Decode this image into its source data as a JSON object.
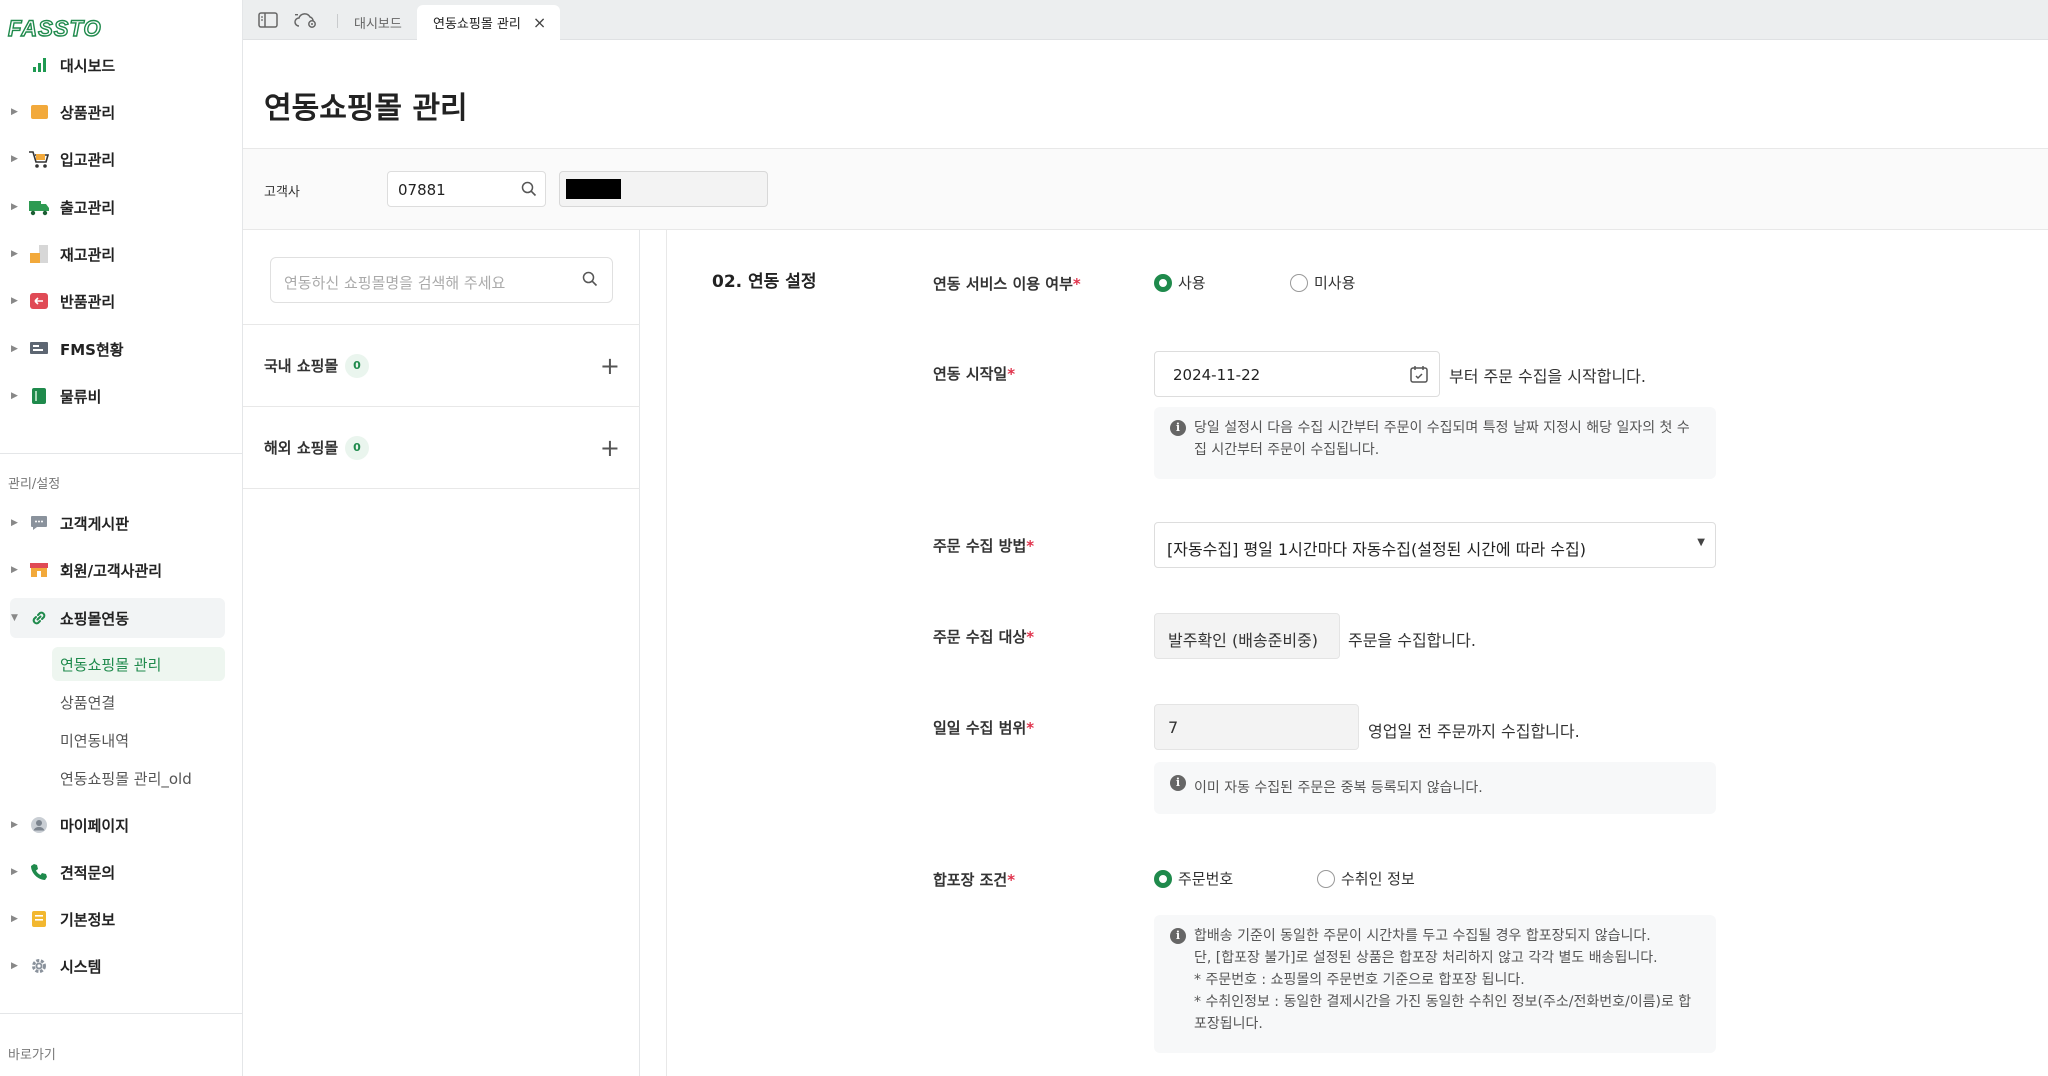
{
  "app": {
    "logo": "FASSTO"
  },
  "sidebar": {
    "menu": [
      {
        "label": "대시보드",
        "icon": "bar-chart-icon"
      },
      {
        "label": "상품관리",
        "icon": "box-icon"
      },
      {
        "label": "입고관리",
        "icon": "cart-icon"
      },
      {
        "label": "출고관리",
        "icon": "truck-icon"
      },
      {
        "label": "재고관리",
        "icon": "stock-icon"
      },
      {
        "label": "반품관리",
        "icon": "return-icon"
      },
      {
        "label": "FMS현황",
        "icon": "monitor-icon"
      },
      {
        "label": "물류비",
        "icon": "book-icon"
      }
    ],
    "admin_section_label": "관리/설정",
    "admin_menu": [
      {
        "label": "고객게시판",
        "icon": "chat-icon"
      },
      {
        "label": "회원/고객사관리",
        "icon": "store-icon"
      },
      {
        "label": "쇼핑몰연동",
        "icon": "link-icon"
      }
    ],
    "submenu": [
      "연동쇼핑몰 관리",
      "상품연결",
      "미연동내역",
      "연동쇼핑몰 관리_old"
    ],
    "bottom_menu": [
      {
        "label": "마이페이지",
        "icon": "user-icon"
      },
      {
        "label": "견적문의",
        "icon": "phone-icon"
      },
      {
        "label": "기본정보",
        "icon": "note-icon"
      },
      {
        "label": "시스템",
        "icon": "gear-icon"
      }
    ],
    "shortcut_label": "바로가기"
  },
  "tabs": {
    "items": [
      "대시보드",
      "연동쇼핑몰 관리"
    ],
    "close": "×"
  },
  "page": {
    "title": "연동쇼핑몰 관리"
  },
  "filter": {
    "label": "고객사",
    "customer_code": "07881"
  },
  "list": {
    "search_placeholder": "연동하신 쇼핑몰명을 검색해 주세요",
    "groups": [
      {
        "name": "국내 쇼핑몰",
        "count": "0"
      },
      {
        "name": "해외 쇼핑몰",
        "count": "0"
      }
    ],
    "plus": "+"
  },
  "settings": {
    "section_title": "02. 연동 설정",
    "service_use": {
      "label": "연동 서비스 이용 여부",
      "options": [
        "사용",
        "미사용"
      ],
      "selected": "사용"
    },
    "start_date": {
      "label": "연동 시작일",
      "value": "2024-11-22",
      "suffix": "부터 주문 수집을 시작합니다.",
      "info": [
        "당일 설정시 다음 수집 시간부터 주문이 수집되며 특정 날짜 지정시 해당 일자의 첫 수",
        "집 시간부터 주문이 수집됩니다."
      ]
    },
    "collect_method": {
      "label": "주문 수집 방법",
      "value": "[자동수집] 평일 1시간마다 자동수집(설정된 시간에 따라 수집)"
    },
    "collect_target": {
      "label": "주문 수집 대상",
      "value": "발주확인 (배송준비중)",
      "suffix": "주문을 수집합니다."
    },
    "daily_range": {
      "label": "일일 수집 범위",
      "value": "7",
      "suffix": "영업일 전 주문까지 수집합니다.",
      "info": [
        "이미 자동 수집된 주문은 중복 등록되지 않습니다."
      ]
    },
    "bundle": {
      "label": "합포장 조건",
      "options": [
        "주문번호",
        "수취인 정보"
      ],
      "selected": "주문번호",
      "info": [
        "합배송 기준이 동일한 주문이 시간차를 두고 수집될 경우 합포장되지 않습니다.",
        "단, [합포장 불가]로 설정된 상품은 합포장 처리하지 않고 각각 별도 배송됩니다.",
        "* 주문번호 : 쇼핑몰의 주문번호 기준으로 합포장 됩니다.",
        "* 수취인정보 : 동일한 결제시간을 가진 동일한 수취인 정보(주소/전화번호/이름)로 합",
        "포장됩니다."
      ]
    },
    "required_mark": "*"
  },
  "colors": {
    "accent": "#1f8a4c",
    "required": "#e0334c"
  }
}
